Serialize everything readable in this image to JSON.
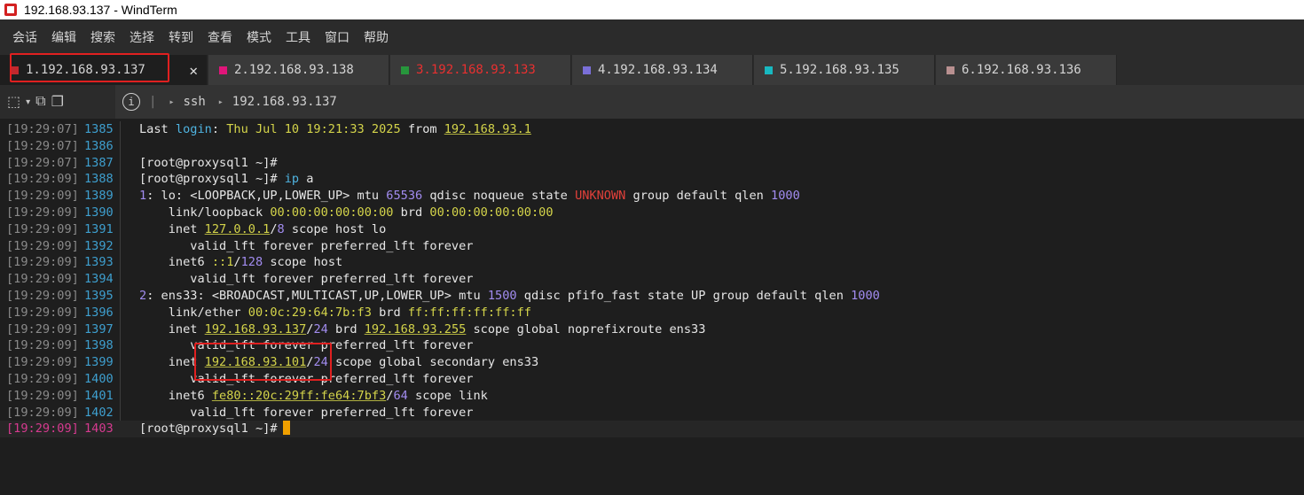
{
  "window": {
    "title": "192.168.93.137 - WindTerm",
    "app_icon": "windterm-logo-icon"
  },
  "menu": [
    "会话",
    "编辑",
    "搜索",
    "选择",
    "转到",
    "查看",
    "模式",
    "工具",
    "窗口",
    "帮助"
  ],
  "tabs": [
    {
      "label": "1.192.168.93.137",
      "color": "#c0282d",
      "text_color": "#d4d4d4",
      "active": true
    },
    {
      "label": "2.192.168.93.138",
      "color": "#e0157a",
      "text_color": "#d4d4d4",
      "active": false
    },
    {
      "label": "3.192.168.93.133",
      "color": "#27963c",
      "text_color": "#e83030",
      "active": false
    },
    {
      "label": "4.192.168.93.134",
      "color": "#7a6fd8",
      "text_color": "#d4d4d4",
      "active": false
    },
    {
      "label": "5.192.168.93.135",
      "color": "#18b8c0",
      "text_color": "#d4d4d4",
      "active": false
    },
    {
      "label": "6.192.168.93.136",
      "color": "#b89090",
      "text_color": "#d4d4d4",
      "active": false
    }
  ],
  "tab_close_glyph": "✕",
  "toolbar": {
    "icons": [
      "new-tab-icon",
      "dropdown-icon",
      "duplicate-icon",
      "copy-session-icon"
    ],
    "info_glyph": "i",
    "path": [
      "ssh",
      "192.168.93.137"
    ]
  },
  "terminal": {
    "lines": [
      {
        "ts": "[19:29:07]",
        "ln": "1385",
        "html": "Last <span class=\"kw\">login</span>: <span class=\"ylw\">Thu Jul 10 19:21:33 2025</span> from <span class=\"ylw ul\">192.168.93.1</span>"
      },
      {
        "ts": "[19:29:07]",
        "ln": "1386",
        "html": ""
      },
      {
        "ts": "[19:29:07]",
        "ln": "1387",
        "html": "[root@proxysql1 ~]#"
      },
      {
        "ts": "[19:29:09]",
        "ln": "1388",
        "html": "[root@proxysql1 ~]# <span class=\"kw\">ip</span> a"
      },
      {
        "ts": "[19:29:09]",
        "ln": "1389",
        "html": "<span class=\"purple\">1</span>: lo: &lt;LOOPBACK,UP,LOWER_UP&gt; mtu <span class=\"purple\">65536</span> qdisc noqueue state <span class=\"red\">UNKNOWN</span> group default qlen <span class=\"purple\">1000</span>"
      },
      {
        "ts": "[19:29:09]",
        "ln": "1390",
        "html": "    link/loopback <span class=\"ylw\">00:00:00:00:00:00</span> brd <span class=\"ylw\">00:00:00:00:00:00</span>"
      },
      {
        "ts": "[19:29:09]",
        "ln": "1391",
        "html": "    inet <span class=\"ylw ul\">127.0.0.1</span>/<span class=\"purple\">8</span> scope host lo"
      },
      {
        "ts": "[19:29:09]",
        "ln": "1392",
        "html": "       valid_lft forever preferred_lft forever"
      },
      {
        "ts": "[19:29:09]",
        "ln": "1393",
        "html": "    inet6 <span class=\"ylw\">::1</span>/<span class=\"purple\">128</span> scope host"
      },
      {
        "ts": "[19:29:09]",
        "ln": "1394",
        "html": "       valid_lft forever preferred_lft forever"
      },
      {
        "ts": "[19:29:09]",
        "ln": "1395",
        "html": "<span class=\"purple\">2</span>: ens33: &lt;BROADCAST,MULTICAST,UP,LOWER_UP&gt; mtu <span class=\"purple\">1500</span> qdisc pfifo_fast state UP group default qlen <span class=\"purple\">1000</span>"
      },
      {
        "ts": "[19:29:09]",
        "ln": "1396",
        "html": "    link/ether <span class=\"ylw\">00:0c:29:64:7b:f3</span> brd <span class=\"ylw\">ff:ff:ff:ff:ff:ff</span>"
      },
      {
        "ts": "[19:29:09]",
        "ln": "1397",
        "html": "    inet <span class=\"ylw ul\">192.168.93.137</span>/<span class=\"purple\">24</span> brd <span class=\"ylw ul\">192.168.93.255</span> scope global noprefixroute ens33"
      },
      {
        "ts": "[19:29:09]",
        "ln": "1398",
        "html": "       valid_lft forever preferred_lft forever"
      },
      {
        "ts": "[19:29:09]",
        "ln": "1399",
        "html": "    inet <span class=\"ylw ul\">192.168.93.101</span>/<span class=\"purple\">24</span> scope global secondary ens33"
      },
      {
        "ts": "[19:29:09]",
        "ln": "1400",
        "html": "       valid_lft forever preferred_lft forever"
      },
      {
        "ts": "[19:29:09]",
        "ln": "1401",
        "html": "    inet6 <span class=\"ylw ul\">fe80::20c:29ff:fe64:7bf3</span>/<span class=\"purple\">64</span> scope link"
      },
      {
        "ts": "[19:29:09]",
        "ln": "1402",
        "html": "       valid_lft forever preferred_lft forever"
      },
      {
        "ts": "[19:29:09]",
        "ln": "1403",
        "html": "[root@proxysql1 ~]#",
        "current": true
      }
    ]
  }
}
